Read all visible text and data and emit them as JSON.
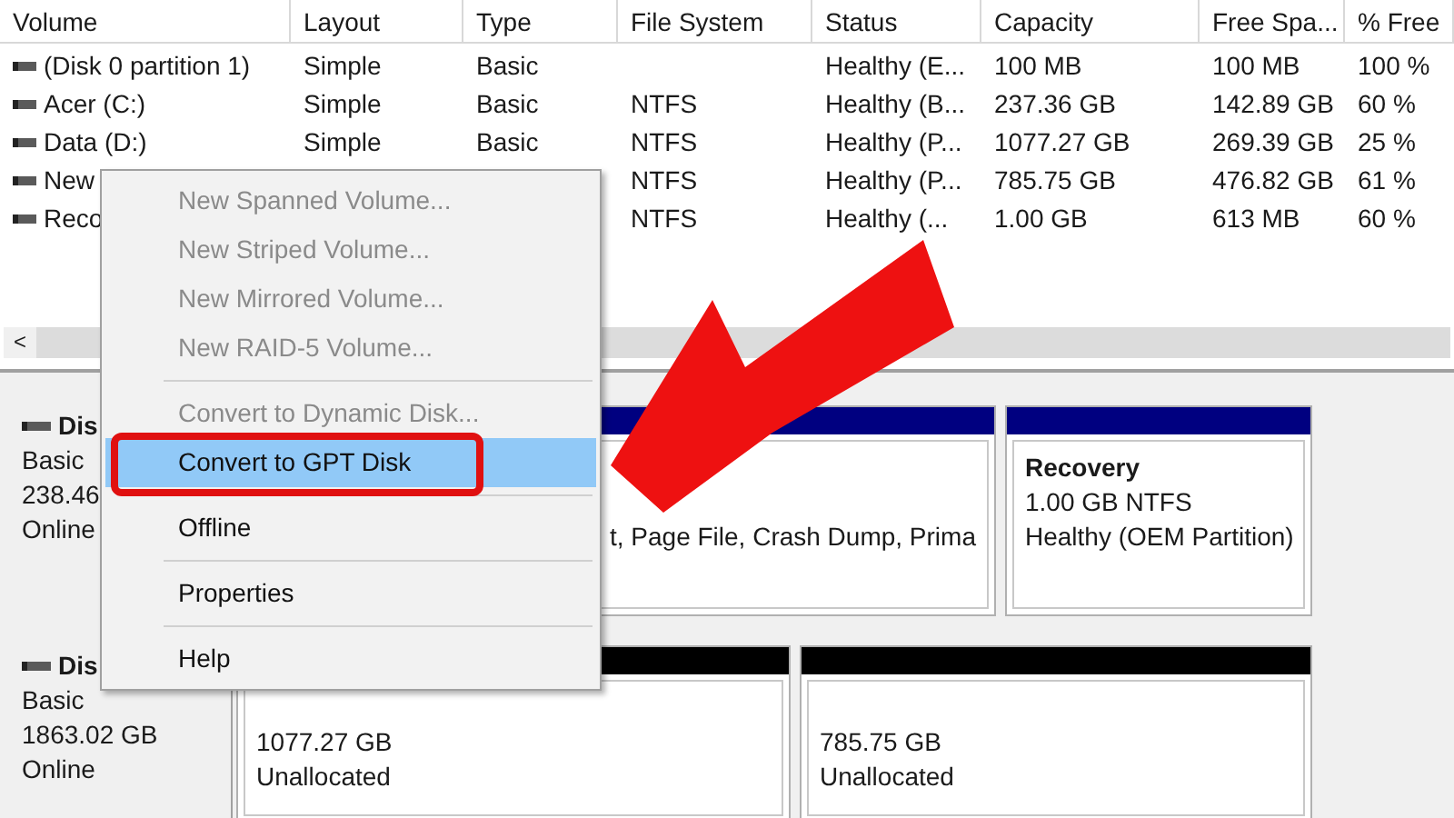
{
  "volume_table": {
    "columns": [
      "Volume",
      "Layout",
      "Type",
      "File System",
      "Status",
      "Capacity",
      "Free Spa...",
      "% Free"
    ],
    "rows": [
      {
        "volume": "(Disk 0 partition 1)",
        "layout": "Simple",
        "type": "Basic",
        "status": "Healthy (E...",
        "capacity": "100 MB",
        "free_space": "100 MB",
        "percent_free": "100 %"
      },
      {
        "volume": "Acer (C:)",
        "layout": "Simple",
        "type": "Basic",
        "file_system": "NTFS",
        "status": "Healthy (B...",
        "capacity": "237.36 GB",
        "free_space": "142.89 GB",
        "percent_free": "60 %"
      },
      {
        "volume": "Data (D:)",
        "layout": "Simple",
        "type": "Basic",
        "file_system": "NTFS",
        "status": "Healthy (P...",
        "capacity": "1077.27 GB",
        "free_space": "269.39 GB",
        "percent_free": "25 %"
      },
      {
        "volume": "New",
        "file_system": "NTFS",
        "status": "Healthy (P...",
        "capacity": "785.75 GB",
        "free_space": "476.82 GB",
        "percent_free": "61 %"
      },
      {
        "volume": "Reco",
        "file_system": "NTFS",
        "status": "Healthy (...",
        "capacity": "1.00 GB",
        "free_space": "613 MB",
        "percent_free": "60 %"
      }
    ],
    "scroll_left": "<"
  },
  "disks": [
    {
      "name": "Dis",
      "type": "Basic",
      "size": "238.46",
      "status": "Online",
      "partitions": [
        {
          "color": "#000080",
          "lines": [
            "t, Page File, Crash Dump, Prima"
          ]
        },
        {
          "color": "#000080",
          "title": "Recovery",
          "lines": [
            "1.00 GB NTFS",
            "Healthy (OEM Partition)"
          ]
        }
      ]
    },
    {
      "name": "Dis",
      "type": "Basic",
      "size": "1863.02 GB",
      "status": "Online",
      "partitions": [
        {
          "color": "#000000",
          "lines": [
            "1077.27 GB",
            "Unallocated"
          ]
        },
        {
          "color": "#000000",
          "lines": [
            "785.75 GB",
            "Unallocated"
          ]
        }
      ]
    }
  ],
  "context_menu": {
    "items": [
      {
        "kind": "item",
        "label": "New Spanned Volume...",
        "disabled": true,
        "selected": false
      },
      {
        "kind": "item",
        "label": "New Striped Volume...",
        "disabled": true,
        "selected": false
      },
      {
        "kind": "item",
        "label": "New Mirrored Volume...",
        "disabled": true,
        "selected": false
      },
      {
        "kind": "item",
        "label": "New RAID-5 Volume...",
        "disabled": true,
        "selected": false
      },
      {
        "kind": "separator"
      },
      {
        "kind": "item",
        "label": "Convert to Dynamic Disk...",
        "disabled": true,
        "selected": false
      },
      {
        "kind": "item",
        "label": "Convert to GPT Disk",
        "disabled": false,
        "selected": true
      },
      {
        "kind": "separator"
      },
      {
        "kind": "item",
        "label": "Offline",
        "disabled": false,
        "selected": false
      },
      {
        "kind": "separator"
      },
      {
        "kind": "item",
        "label": "Properties",
        "disabled": false,
        "selected": false
      },
      {
        "kind": "separator"
      },
      {
        "kind": "item",
        "label": "Help",
        "disabled": false,
        "selected": false
      }
    ]
  }
}
